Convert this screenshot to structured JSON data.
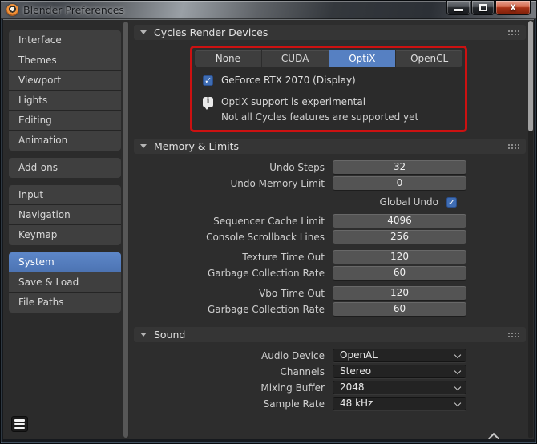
{
  "window": {
    "title": "Blender Preferences"
  },
  "sidebar": {
    "groups": [
      {
        "items": [
          "Interface",
          "Themes",
          "Viewport",
          "Lights",
          "Editing",
          "Animation"
        ]
      },
      {
        "items": [
          "Add-ons"
        ]
      },
      {
        "items": [
          "Input",
          "Navigation",
          "Keymap"
        ]
      },
      {
        "items": [
          "System",
          "Save & Load",
          "File Paths"
        ]
      }
    ],
    "active_item": "System"
  },
  "cycles": {
    "title": "Cycles Render Devices",
    "tabs": [
      "None",
      "CUDA",
      "OptiX",
      "OpenCL"
    ],
    "active_tab": "OptiX",
    "device_label": "GeForce RTX 2070 (Display)",
    "device_checked": true,
    "info_line1": "OptiX support is experimental",
    "info_line2": "Not all Cycles features are supported yet"
  },
  "memory": {
    "title": "Memory & Limits",
    "rows": [
      {
        "label": "Undo Steps",
        "value": "32"
      },
      {
        "label": "Undo Memory Limit",
        "value": "0"
      },
      {
        "label": "Global Undo",
        "checked": true
      },
      {
        "label": "Sequencer Cache Limit",
        "value": "4096"
      },
      {
        "label": "Console Scrollback Lines",
        "value": "256"
      },
      {
        "label": "Texture Time Out",
        "value": "120"
      },
      {
        "label": "Garbage Collection Rate",
        "value": "60"
      },
      {
        "label": "Vbo Time Out",
        "value": "120"
      },
      {
        "label": "Garbage Collection Rate",
        "value": "60"
      }
    ]
  },
  "sound": {
    "title": "Sound",
    "rows": [
      {
        "label": "Audio Device",
        "value": "OpenAL"
      },
      {
        "label": "Channels",
        "value": "Stereo"
      },
      {
        "label": "Mixing Buffer",
        "value": "2048"
      },
      {
        "label": "Sample Rate",
        "value": "48 kHz"
      }
    ]
  },
  "colors": {
    "accent_blue": "#5680c2",
    "checkbox_blue": "#3f6db4",
    "highlight_red": "#cc1111"
  }
}
